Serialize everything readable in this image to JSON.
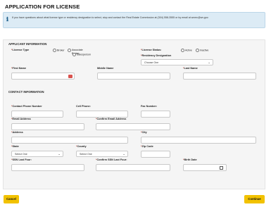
{
  "page": {
    "title": "APPLICATION FOR LICENSE",
    "info_icon": "info-icon",
    "info_text": "If you have questions about what license type or residency designation to select, stop and contact the Real Estate Commission at (304) 558-3555 or by email at wvrec@wv.gov."
  },
  "applicant": {
    "section_title": "APPLICANT INFORMATION",
    "license_type_label": "License Type",
    "license_types": [
      "Broker",
      "Associate Broker",
      "Salesperson"
    ],
    "license_status_label": "License Status:",
    "license_statuses": [
      "Active",
      "Inactive"
    ],
    "residency_label": "Residency Designation",
    "residency_value": "Choose One",
    "first_name_label": "First Name",
    "middle_name_label": "Middle Name",
    "last_name_label": "Last Name",
    "required_marker": "*"
  },
  "contact": {
    "section_title": "CONTACT INFORMATION",
    "contact_phone_label": "Contact Phone Number",
    "cell_phone_label": "Cell Phone:",
    "fax_label": "Fax Number:",
    "email_label": "Email Address",
    "confirm_email_label": "Confirm Email Address",
    "address_label": "Address",
    "city_label": "City",
    "state_label": "State",
    "state_value": "Select One",
    "county_label": "County",
    "county_value": "Select One",
    "zip_label": "Zip Code",
    "ssn_label": "SSN Last Four:",
    "confirm_ssn_label": "Confirm SSN Last Four:",
    "birth_date_label": "Birth Date"
  },
  "buttons": {
    "cancel": "Cancel",
    "continue": "Continue"
  },
  "colors": {
    "accent_button": "#f2c200",
    "required": "#c0392b",
    "info_bg": "#dcebf5"
  }
}
